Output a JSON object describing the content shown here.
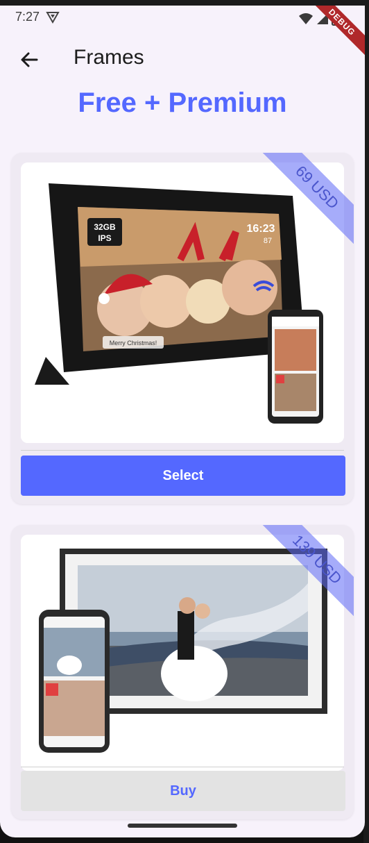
{
  "status_bar": {
    "time": "7:27",
    "debug_label": "DEBUG"
  },
  "app_bar": {
    "title": "Frames"
  },
  "heading": "Free + Premium",
  "cards": [
    {
      "price": "69 USD",
      "button_label": "Select",
      "photo_badge": "32GB IPS",
      "clock": "16:23",
      "temp": "87",
      "greeting": "Merry Christmas!"
    },
    {
      "price": "139 USD",
      "button_label": "Buy"
    }
  ],
  "colors": {
    "accent": "#5468ff",
    "background": "#f7f2fb",
    "ribbon": "#5c68f6"
  },
  "icons": [
    "back-arrow-icon",
    "wifi-icon",
    "signal-icon",
    "battery-icon"
  ]
}
